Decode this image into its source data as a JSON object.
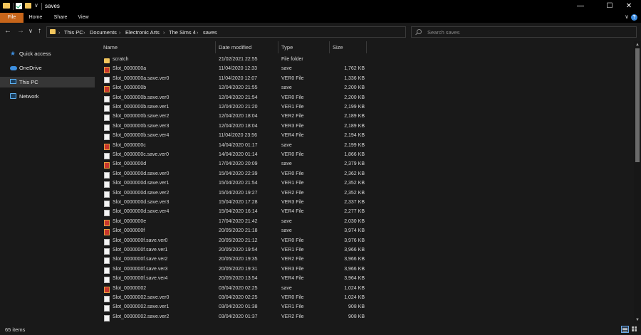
{
  "window": {
    "title": "saves",
    "quick_access_dropdown": "∨",
    "minimize": "—",
    "maximize": "☐",
    "close": "✕"
  },
  "ribbon": {
    "tabs": [
      "File",
      "Home",
      "Share",
      "View"
    ],
    "expand": "∨",
    "help": "?"
  },
  "nav": {
    "back": "←",
    "forward": "→",
    "recent": "∨",
    "up": "↑"
  },
  "address": {
    "breadcrumbs": [
      "This PC",
      "Documents",
      "Electronic Arts",
      "The Sims 4",
      "saves"
    ],
    "separator": "›",
    "dropdown": "∨",
    "refresh": "↻"
  },
  "search": {
    "placeholder": "Search saves"
  },
  "sidebar": {
    "items": [
      {
        "label": "Quick access",
        "icon": "star-icon"
      },
      {
        "label": "OneDrive",
        "icon": "cloud-icon"
      },
      {
        "label": "This PC",
        "icon": "computer-icon",
        "selected": true
      },
      {
        "label": "Network",
        "icon": "network-icon"
      }
    ]
  },
  "columns": {
    "name": "Name",
    "date": "Date modified",
    "type": "Type",
    "size": "Size",
    "sort_caret": "^"
  },
  "files": [
    {
      "name": "scratch",
      "date": "21/02/2021 22:55",
      "type": "File folder",
      "size": "",
      "icon": "folder-icon"
    },
    {
      "name": "Slot_0000000a",
      "date": "11/04/2020 12:33",
      "type": "save",
      "size": "1,762 KB",
      "icon": "save-file-icon"
    },
    {
      "name": "Slot_0000000a.save.ver0",
      "date": "11/04/2020 12:07",
      "type": "VER0 File",
      "size": "1,336 KB",
      "icon": "file-icon"
    },
    {
      "name": "Slot_0000000b",
      "date": "12/04/2020 21:55",
      "type": "save",
      "size": "2,200 KB",
      "icon": "save-file-icon"
    },
    {
      "name": "Slot_0000000b.save.ver0",
      "date": "12/04/2020 21:54",
      "type": "VER0 File",
      "size": "2,200 KB",
      "icon": "file-icon"
    },
    {
      "name": "Slot_0000000b.save.ver1",
      "date": "12/04/2020 21:20",
      "type": "VER1 File",
      "size": "2,199 KB",
      "icon": "file-icon"
    },
    {
      "name": "Slot_0000000b.save.ver2",
      "date": "12/04/2020 18:04",
      "type": "VER2 File",
      "size": "2,189 KB",
      "icon": "file-icon"
    },
    {
      "name": "Slot_0000000b.save.ver3",
      "date": "12/04/2020 18:04",
      "type": "VER3 File",
      "size": "2,189 KB",
      "icon": "file-icon"
    },
    {
      "name": "Slot_0000000b.save.ver4",
      "date": "11/04/2020 23:56",
      "type": "VER4 File",
      "size": "2,194 KB",
      "icon": "file-icon"
    },
    {
      "name": "Slot_0000000c",
      "date": "14/04/2020 01:17",
      "type": "save",
      "size": "2,199 KB",
      "icon": "save-file-icon"
    },
    {
      "name": "Slot_0000000c.save.ver0",
      "date": "14/04/2020 01:14",
      "type": "VER0 File",
      "size": "1,866 KB",
      "icon": "file-icon"
    },
    {
      "name": "Slot_0000000d",
      "date": "17/04/2020 20:09",
      "type": "save",
      "size": "2,379 KB",
      "icon": "save-file-icon"
    },
    {
      "name": "Slot_0000000d.save.ver0",
      "date": "15/04/2020 22:39",
      "type": "VER0 File",
      "size": "2,362 KB",
      "icon": "file-icon"
    },
    {
      "name": "Slot_0000000d.save.ver1",
      "date": "15/04/2020 21:54",
      "type": "VER1 File",
      "size": "2,352 KB",
      "icon": "file-icon"
    },
    {
      "name": "Slot_0000000d.save.ver2",
      "date": "15/04/2020 19:27",
      "type": "VER2 File",
      "size": "2,352 KB",
      "icon": "file-icon"
    },
    {
      "name": "Slot_0000000d.save.ver3",
      "date": "15/04/2020 17:28",
      "type": "VER3 File",
      "size": "2,337 KB",
      "icon": "file-icon"
    },
    {
      "name": "Slot_0000000d.save.ver4",
      "date": "15/04/2020 16:14",
      "type": "VER4 File",
      "size": "2,277 KB",
      "icon": "file-icon"
    },
    {
      "name": "Slot_0000000e",
      "date": "17/04/2020 21:42",
      "type": "save",
      "size": "2,030 KB",
      "icon": "save-file-icon"
    },
    {
      "name": "Slot_0000000f",
      "date": "20/05/2020 21:18",
      "type": "save",
      "size": "3,974 KB",
      "icon": "save-file-icon"
    },
    {
      "name": "Slot_0000000f.save.ver0",
      "date": "20/05/2020 21:12",
      "type": "VER0 File",
      "size": "3,976 KB",
      "icon": "file-icon"
    },
    {
      "name": "Slot_0000000f.save.ver1",
      "date": "20/05/2020 19:54",
      "type": "VER1 File",
      "size": "3,966 KB",
      "icon": "file-icon"
    },
    {
      "name": "Slot_0000000f.save.ver2",
      "date": "20/05/2020 19:35",
      "type": "VER2 File",
      "size": "3,966 KB",
      "icon": "file-icon"
    },
    {
      "name": "Slot_0000000f.save.ver3",
      "date": "20/05/2020 19:31",
      "type": "VER3 File",
      "size": "3,966 KB",
      "icon": "file-icon"
    },
    {
      "name": "Slot_0000000f.save.ver4",
      "date": "20/05/2020 13:54",
      "type": "VER4 File",
      "size": "3,964 KB",
      "icon": "file-icon"
    },
    {
      "name": "Slot_00000002",
      "date": "03/04/2020 02:25",
      "type": "save",
      "size": "1,024 KB",
      "icon": "save-file-icon"
    },
    {
      "name": "Slot_00000002.save.ver0",
      "date": "03/04/2020 02:25",
      "type": "VER0 File",
      "size": "1,024 KB",
      "icon": "file-icon"
    },
    {
      "name": "Slot_00000002.save.ver1",
      "date": "03/04/2020 01:38",
      "type": "VER1 File",
      "size": "908 KB",
      "icon": "file-icon"
    },
    {
      "name": "Slot_00000002.save.ver2",
      "date": "03/04/2020 01:37",
      "type": "VER2 File",
      "size": "908 KB",
      "icon": "file-icon"
    }
  ],
  "scrollbar": {
    "up": "▲",
    "down": "▼"
  },
  "status": {
    "item_count": "65 items"
  },
  "colors": {
    "background": "#191919",
    "title_bar": "#000000",
    "file_tab": "#c7651a",
    "folder": "#f2c55c",
    "accent": "#3d8fe0"
  }
}
